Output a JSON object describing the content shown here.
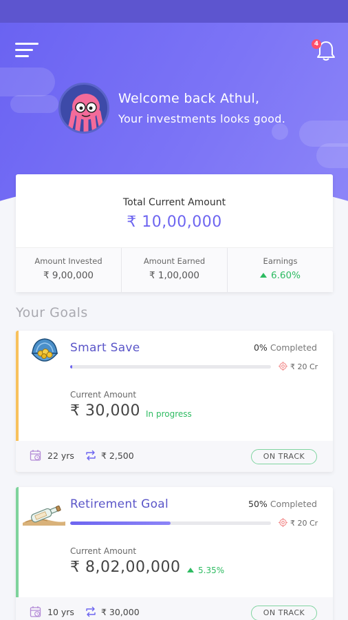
{
  "header": {
    "notification_count": "4",
    "welcome_line1": "Welcome back Athul,",
    "welcome_line2": "Your investments looks good."
  },
  "summary": {
    "label": "Total Current Amount",
    "amount": "₹ 10,00,000",
    "stats": [
      {
        "label": "Amount Invested",
        "value": "₹ 9,00,000"
      },
      {
        "label": "Amount Earned",
        "value": "₹ 1,00,000"
      },
      {
        "label": "Earnings",
        "value": "6.60%"
      }
    ]
  },
  "goals_title": "Your Goals",
  "goals": [
    {
      "name": "Smart Save",
      "completed_pct": "0%",
      "completed_label": "Completed",
      "progress": 0.01,
      "target": "₹ 20 Cr",
      "current_label": "Current Amount",
      "current_amount": "₹ 30,000",
      "status": "In progress",
      "duration": "22 yrs",
      "installment": "₹ 2,500",
      "track": "ON TRACK",
      "accent_color": "#f8c15c"
    },
    {
      "name": "Retirement Goal",
      "completed_pct": "50%",
      "completed_label": "Completed",
      "progress": 0.5,
      "target": "₹ 20 Cr",
      "current_label": "Current Amount",
      "current_amount": "₹ 8,02,00,000",
      "status": "5.35%",
      "duration": "10 yrs",
      "installment": "₹ 30,000",
      "track": "ON TRACK",
      "accent_color": "#7ed39c"
    }
  ],
  "colors": {
    "accent": "#6d65f0",
    "positive": "#2dbb61",
    "badge": "#ff4f6b"
  },
  "icons": [
    "menu-icon",
    "bell-icon",
    "avatar-octopus",
    "target-icon",
    "calendar-clock-icon",
    "repeat-icon",
    "up-arrow-icon"
  ]
}
